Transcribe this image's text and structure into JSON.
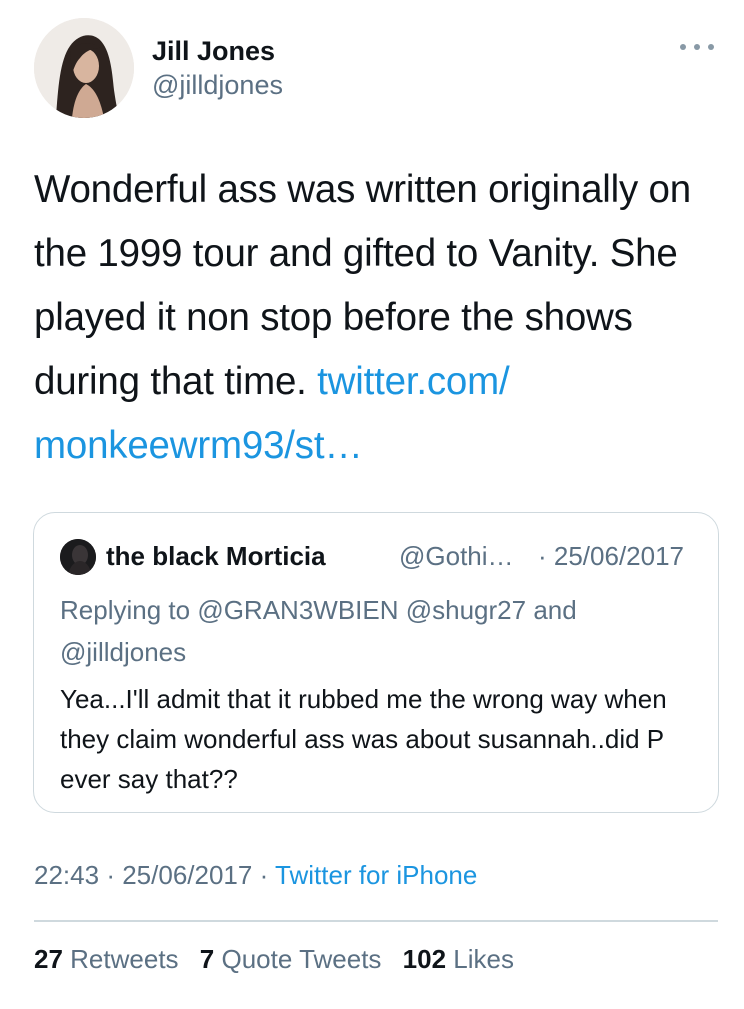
{
  "author": {
    "name": "Jill Jones",
    "handle": "@jilldjones"
  },
  "tweet": {
    "text": "Wonderful ass was written originally on the 1999 tour and gifted to Vanity. She played it non stop before the shows during that time.",
    "link": "twitter.com/ monkeewrm93/st…"
  },
  "quoted_tweet": {
    "name": "the black Morticia",
    "handle": "@Gothi…",
    "date": "· 25/06/2017",
    "replying_prefix": "Replying to",
    "replying_to": "@GRAN3WBIEN @shugr27",
    "replying_and": "and",
    "replying_last": "@jilldjones",
    "text": "Yea...I'll admit that it rubbed me the wrong way when they claim wonderful ass was about susannah..did P ever say that??"
  },
  "meta": {
    "time": "22:43",
    "sep1": "·",
    "date": "25/06/2017",
    "sep2": "·",
    "source": "Twitter for iPhone"
  },
  "stats": {
    "retweets_count": "27",
    "retweets_label": "Retweets",
    "quotes_count": "7",
    "quotes_label": "Quote Tweets",
    "likes_count": "102",
    "likes_label": "Likes"
  }
}
